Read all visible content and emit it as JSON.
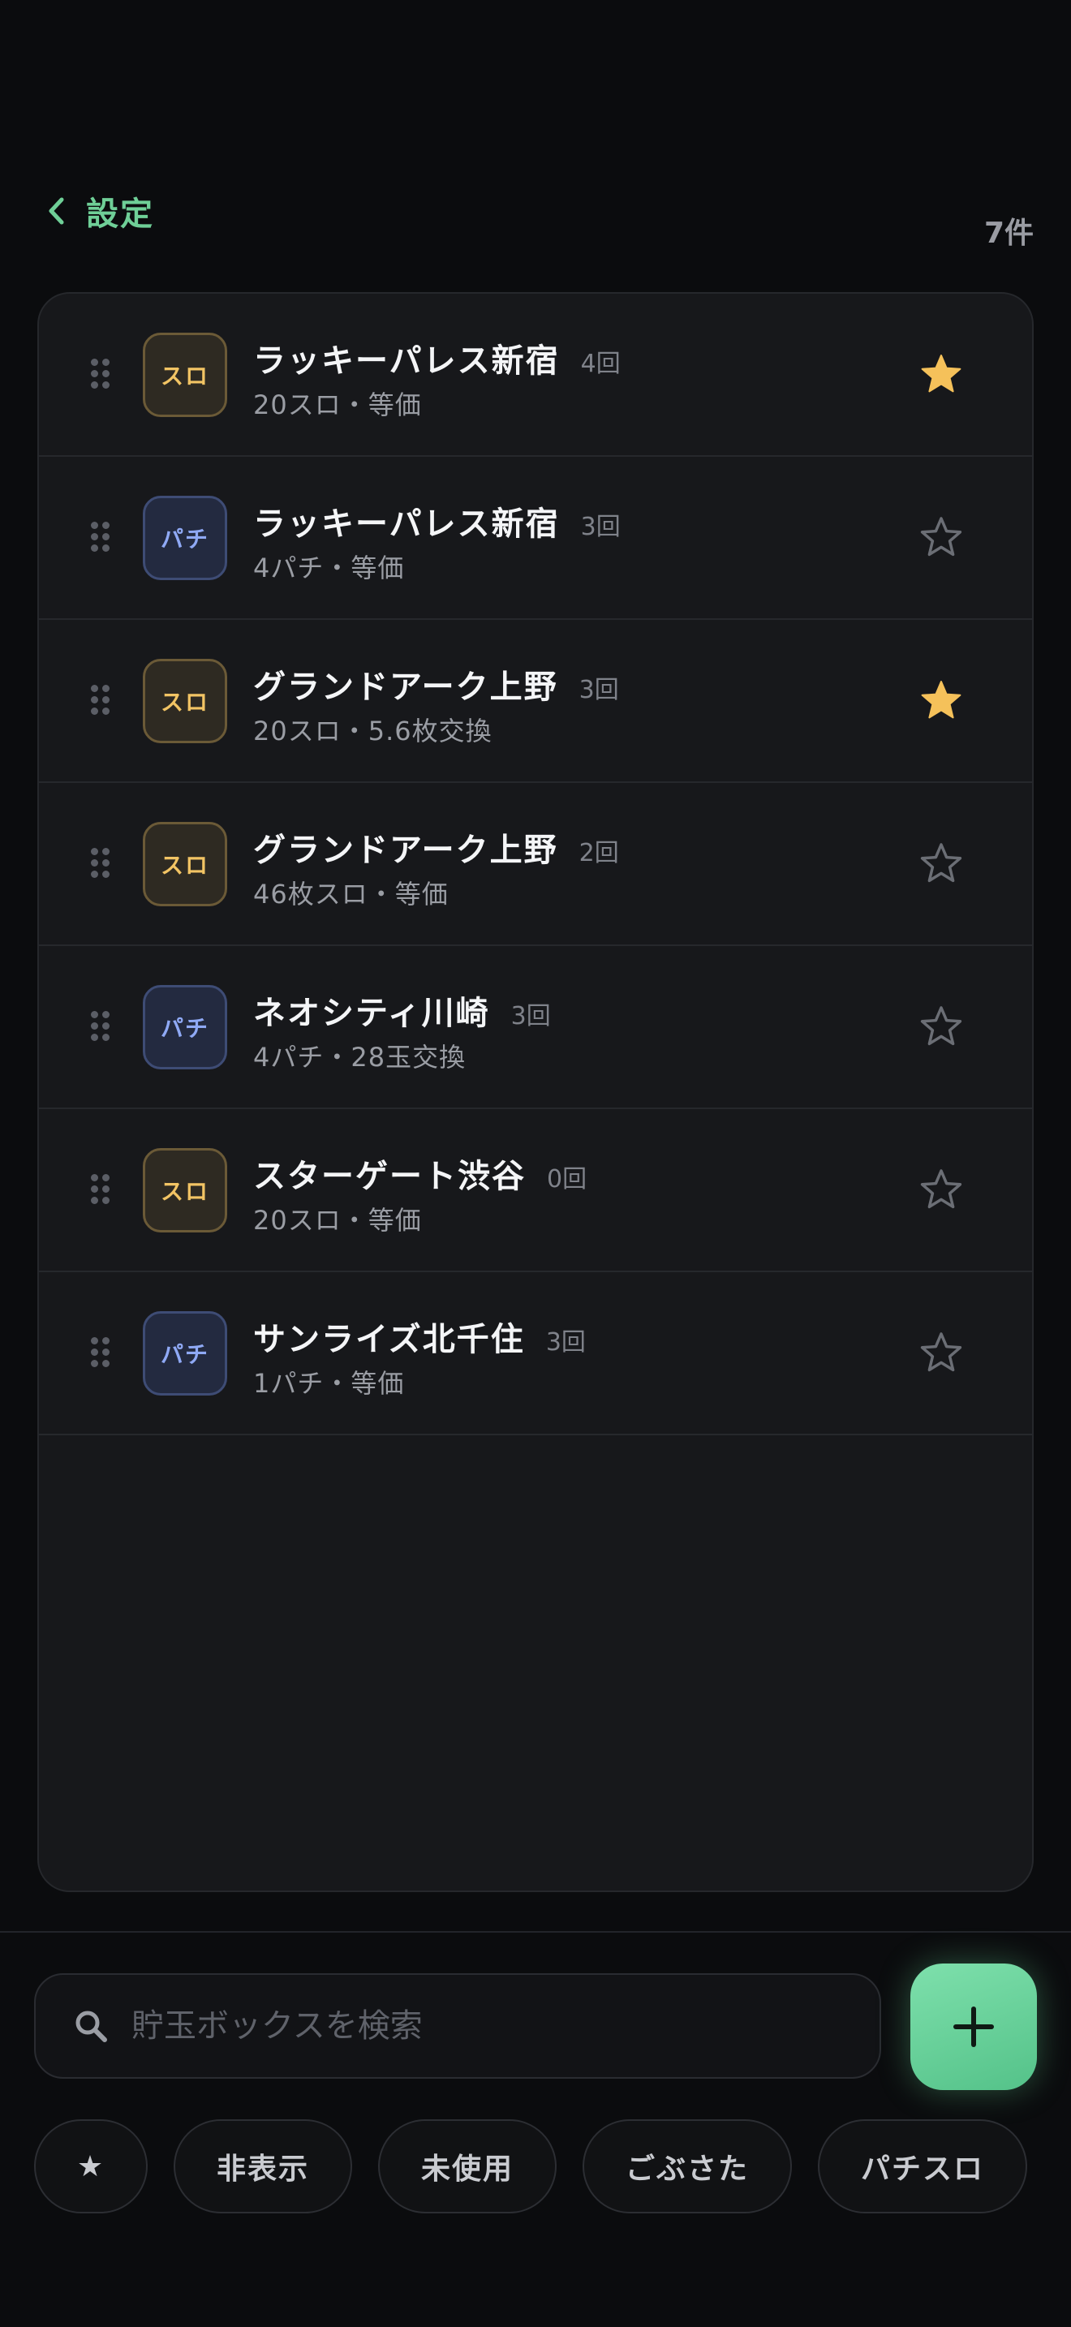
{
  "header": {
    "back_label": "設定",
    "count_label": "7件"
  },
  "list": [
    {
      "name": "ラッキーパレス新宿",
      "visits": "4回",
      "sub": "20スロ・等価",
      "type_label": "スロ",
      "type": "slot",
      "favorite": true
    },
    {
      "name": "ラッキーパレス新宿",
      "visits": "3回",
      "sub": "4パチ・等価",
      "type_label": "パチ",
      "type": "pachi",
      "favorite": false
    },
    {
      "name": "グランドアーク上野",
      "visits": "3回",
      "sub": "20スロ・5.6枚交換",
      "type_label": "スロ",
      "type": "slot",
      "favorite": true
    },
    {
      "name": "グランドアーク上野",
      "visits": "2回",
      "sub": "46枚スロ・等価",
      "type_label": "スロ",
      "type": "slot",
      "favorite": false
    },
    {
      "name": "ネオシティ川崎",
      "visits": "3回",
      "sub": "4パチ・28玉交換",
      "type_label": "パチ",
      "type": "pachi",
      "favorite": false
    },
    {
      "name": "スターゲート渋谷",
      "visits": "0回",
      "sub": "20スロ・等価",
      "type_label": "スロ",
      "type": "slot",
      "favorite": false
    },
    {
      "name": "サンライズ北千住",
      "visits": "3回",
      "sub": "1パチ・等価",
      "type_label": "パチ",
      "type": "pachi",
      "favorite": false
    }
  ],
  "search": {
    "placeholder": "貯玉ボックスを検索",
    "value": ""
  },
  "filters": {
    "favorite_icon": "★",
    "hidden": "非表示",
    "unused": "未使用",
    "long_time": "ごぶさた",
    "pachislo": "パチスロ"
  },
  "colors": {
    "accent": "#6fcf97",
    "star_active": "#f5c15a",
    "star_inactive": "#6b6e75",
    "slot_badge": "#f2c464",
    "pachi_badge": "#8fa9f5"
  }
}
